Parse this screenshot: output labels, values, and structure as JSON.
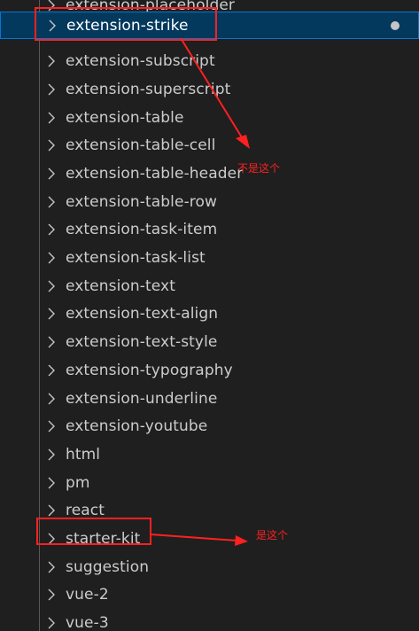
{
  "explorer": {
    "items": [
      {
        "label": "extension-placeholder"
      },
      {
        "label": "extension-strike",
        "selected": true,
        "modified_dot": true
      },
      {
        "label": "extension-subscript"
      },
      {
        "label": "extension-superscript"
      },
      {
        "label": "extension-table"
      },
      {
        "label": "extension-table-cell"
      },
      {
        "label": "extension-table-header"
      },
      {
        "label": "extension-table-row"
      },
      {
        "label": "extension-task-item"
      },
      {
        "label": "extension-task-list"
      },
      {
        "label": "extension-text"
      },
      {
        "label": "extension-text-align"
      },
      {
        "label": "extension-text-style"
      },
      {
        "label": "extension-typography"
      },
      {
        "label": "extension-underline"
      },
      {
        "label": "extension-youtube"
      },
      {
        "label": "html"
      },
      {
        "label": "pm"
      },
      {
        "label": "react"
      },
      {
        "label": "starter-kit"
      },
      {
        "label": "suggestion"
      },
      {
        "label": "vue-2"
      },
      {
        "label": "vue-3"
      }
    ]
  },
  "annotations": {
    "note_not_this": "不是这个",
    "note_is_this": "是这个",
    "color": "#ff2020"
  },
  "icons": {
    "row_icon": "chevron-right-icon",
    "modified": "modified-dot-icon"
  },
  "colors": {
    "background": "#1f1f1f",
    "selection_bg": "#04395e",
    "selection_border": "#0078d4",
    "text": "#cccccc"
  }
}
